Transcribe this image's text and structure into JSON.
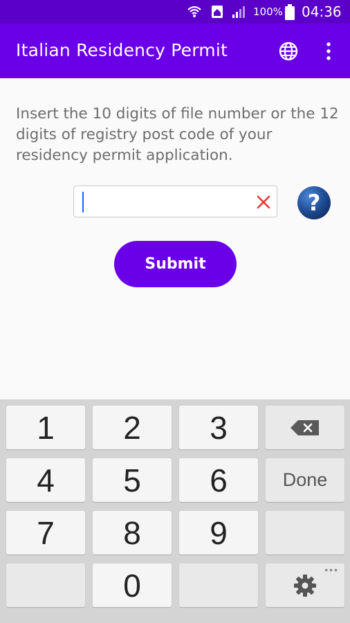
{
  "status_bar": {
    "battery_percent": "100%",
    "time": "04:36",
    "icons": [
      "wifi-icon",
      "home-sim-icon",
      "signal-icon",
      "battery-icon"
    ]
  },
  "app_bar": {
    "title": "Italian Residency Permit",
    "actions": [
      "globe-icon",
      "overflow-menu-icon"
    ],
    "color": "#6a00e8"
  },
  "main": {
    "instructions": "Insert the 10 digits of file number or the 12 digits of registry post code of your residency permit application.",
    "input": {
      "value": "",
      "placeholder": ""
    },
    "submit_label": "Submit"
  },
  "keyboard": {
    "keys": [
      "1",
      "2",
      "3",
      "4",
      "5",
      "6",
      "7",
      "8",
      "9",
      "0"
    ],
    "done_label": "Done",
    "more_indicator": "•••"
  },
  "colors": {
    "accent": "#6a00e8",
    "status_bar": "#5a00c8",
    "clear_x": "#e53935",
    "help": "#1f4e96"
  }
}
